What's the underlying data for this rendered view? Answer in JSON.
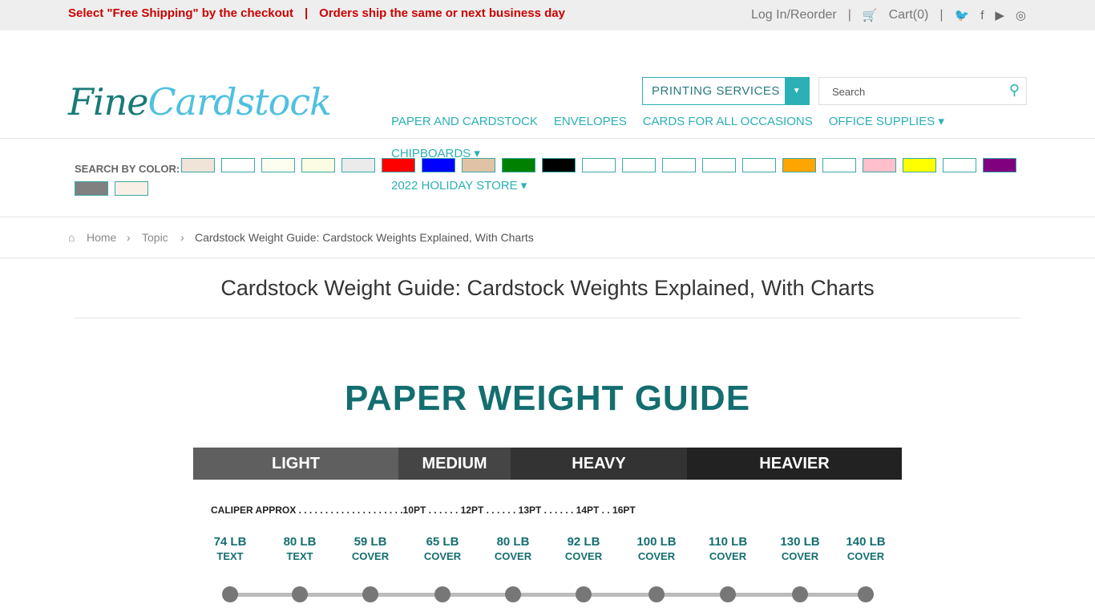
{
  "topbar": {
    "promo1": "Select \"Free Shipping\" by the checkout",
    "sep": "|",
    "promo2": "Orders ship the same or next business day",
    "login": "Log In/Reorder",
    "cart": "Cart(0)"
  },
  "header": {
    "logo_a": "Fine",
    "logo_b": "Cardstock",
    "printing": "PRINTING SERVICES",
    "search_placeholder": "Search",
    "nav": [
      "PAPER AND CARDSTOCK",
      "ENVELOPES",
      "CARDS FOR ALL OCCASIONS",
      "OFFICE SUPPLIES ▾",
      "CHIPBOARDS ▾",
      "2022 HOLIDAY STORE ▾"
    ]
  },
  "colors": {
    "label": "SEARCH BY COLOR:",
    "swatches": [
      "#f0e4d8",
      "#ffffff",
      "#fdfdf0",
      "#fcfbe3",
      "#ebebeb",
      "#ff0000",
      "#0000ff",
      "#dfc3a4",
      "#008000",
      "#000000",
      "#ffffff",
      "#ffffff",
      "#ffffff",
      "#ffffff",
      "#ffffff",
      "#ffa500",
      "#ffffff",
      "#ffc0cb",
      "#ffff00",
      "#ffffff",
      "#800080",
      "#808080",
      "#f8f0e6"
    ]
  },
  "breadcrumb": {
    "home": "Home",
    "topic": "Topic",
    "current": "Cardstock Weight Guide: Cardstock Weights Explained, With Charts"
  },
  "page_title": "Cardstock Weight Guide: Cardstock Weights Explained, With Charts",
  "guide": {
    "title": "PAPER WEIGHT GUIDE",
    "bands": [
      {
        "label": "LIGHT",
        "color": "#5f5f5f"
      },
      {
        "label": "MEDIUM",
        "color": "#454545"
      },
      {
        "label": "HEAVY",
        "color": "#333333"
      },
      {
        "label": "HEAVIER",
        "color": "#222222"
      }
    ],
    "caliper": "CALIPER APPROX . . . . . . . . . . . . . . . . . . . .10PT . . . . . . 12PT  . . . . . . 13PT . . . . . . 14PT . . 16PT",
    "weights": [
      {
        "w": "74 LB",
        "t": "TEXT"
      },
      {
        "w": "80 LB",
        "t": "TEXT"
      },
      {
        "w": "59 LB",
        "t": "COVER"
      },
      {
        "w": "65 LB",
        "t": "COVER"
      },
      {
        "w": "80 LB",
        "t": "COVER"
      },
      {
        "w": "92 LB",
        "t": "COVER"
      },
      {
        "w": "100 LB",
        "t": "COVER"
      },
      {
        "w": "110 LB",
        "t": "COVER"
      },
      {
        "w": "130 LB",
        "t": "COVER"
      },
      {
        "w": "140 LB",
        "t": "COVER"
      }
    ]
  }
}
